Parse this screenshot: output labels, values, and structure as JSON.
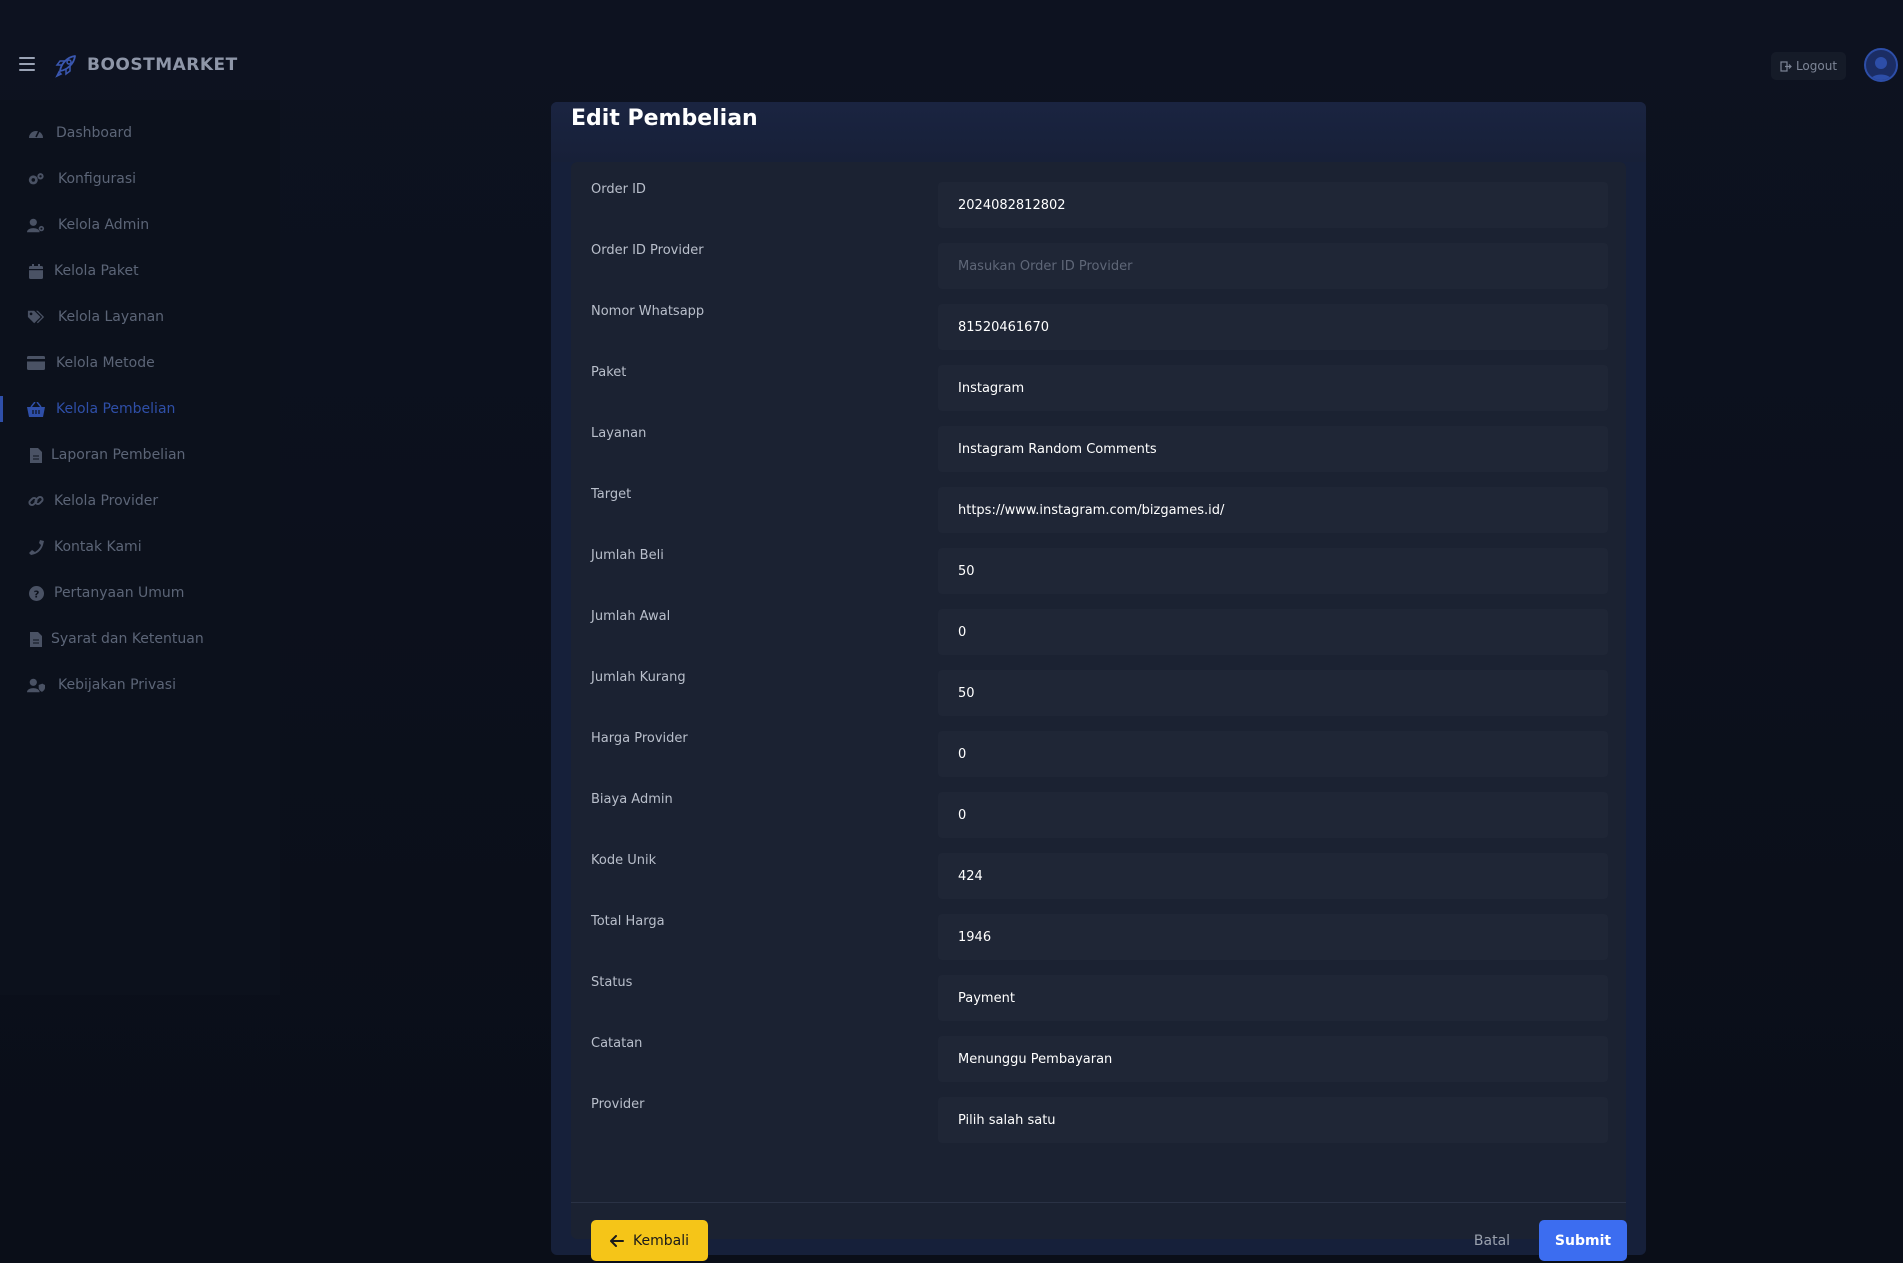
{
  "brand": {
    "name": "BOOSTMARKET"
  },
  "topbar": {
    "logout_label": "Logout"
  },
  "sidebar": {
    "items": [
      {
        "label": "Dashboard",
        "icon": "dashboard-icon"
      },
      {
        "label": "Konfigurasi",
        "icon": "gears-icon"
      },
      {
        "label": "Kelola Admin",
        "icon": "user-cog-icon"
      },
      {
        "label": "Kelola Paket",
        "icon": "calendar-icon"
      },
      {
        "label": "Kelola Layanan",
        "icon": "tags-icon"
      },
      {
        "label": "Kelola Metode",
        "icon": "credit-card-icon"
      },
      {
        "label": "Kelola Pembelian",
        "icon": "basket-icon",
        "active": true
      },
      {
        "label": "Laporan Pembelian",
        "icon": "file-icon"
      },
      {
        "label": "Kelola Provider",
        "icon": "link-icon"
      },
      {
        "label": "Kontak Kami",
        "icon": "phone-icon"
      },
      {
        "label": "Pertanyaan Umum",
        "icon": "question-icon"
      },
      {
        "label": "Syarat dan Ketentuan",
        "icon": "file-icon"
      },
      {
        "label": "Kebijakan Privasi",
        "icon": "user-shield-icon"
      }
    ]
  },
  "form": {
    "title": "Edit Pembelian",
    "fields": [
      {
        "label": "Order ID",
        "value": "2024082812802",
        "placeholder": ""
      },
      {
        "label": "Order ID Provider",
        "value": "",
        "placeholder": "Masukan Order ID Provider"
      },
      {
        "label": "Nomor Whatsapp",
        "value": "81520461670",
        "placeholder": ""
      },
      {
        "label": "Paket",
        "value": "Instagram",
        "placeholder": ""
      },
      {
        "label": "Layanan",
        "value": "Instagram Random Comments",
        "placeholder": ""
      },
      {
        "label": "Target",
        "value": "https://www.instagram.com/bizgames.id/",
        "placeholder": ""
      },
      {
        "label": "Jumlah Beli",
        "value": "50",
        "placeholder": ""
      },
      {
        "label": "Jumlah Awal",
        "value": "0",
        "placeholder": ""
      },
      {
        "label": "Jumlah Kurang",
        "value": "50",
        "placeholder": ""
      },
      {
        "label": "Harga Provider",
        "value": "0",
        "placeholder": ""
      },
      {
        "label": "Biaya Admin",
        "value": "0",
        "placeholder": ""
      },
      {
        "label": "Kode Unik",
        "value": "424",
        "placeholder": ""
      },
      {
        "label": "Total Harga",
        "value": "1946",
        "placeholder": ""
      },
      {
        "label": "Status",
        "value": "Payment",
        "placeholder": ""
      },
      {
        "label": "Catatan",
        "value": "Menunggu Pembayaran",
        "placeholder": ""
      },
      {
        "label": "Provider",
        "value": "Pilih salah satu",
        "placeholder": ""
      }
    ],
    "back_label": "Kembali",
    "cancel_label": "Batal",
    "submit_label": "Submit"
  },
  "colors": {
    "accent": "#3c6df0",
    "back_button": "#f5c518",
    "active_nav": "#2f4fa8"
  }
}
